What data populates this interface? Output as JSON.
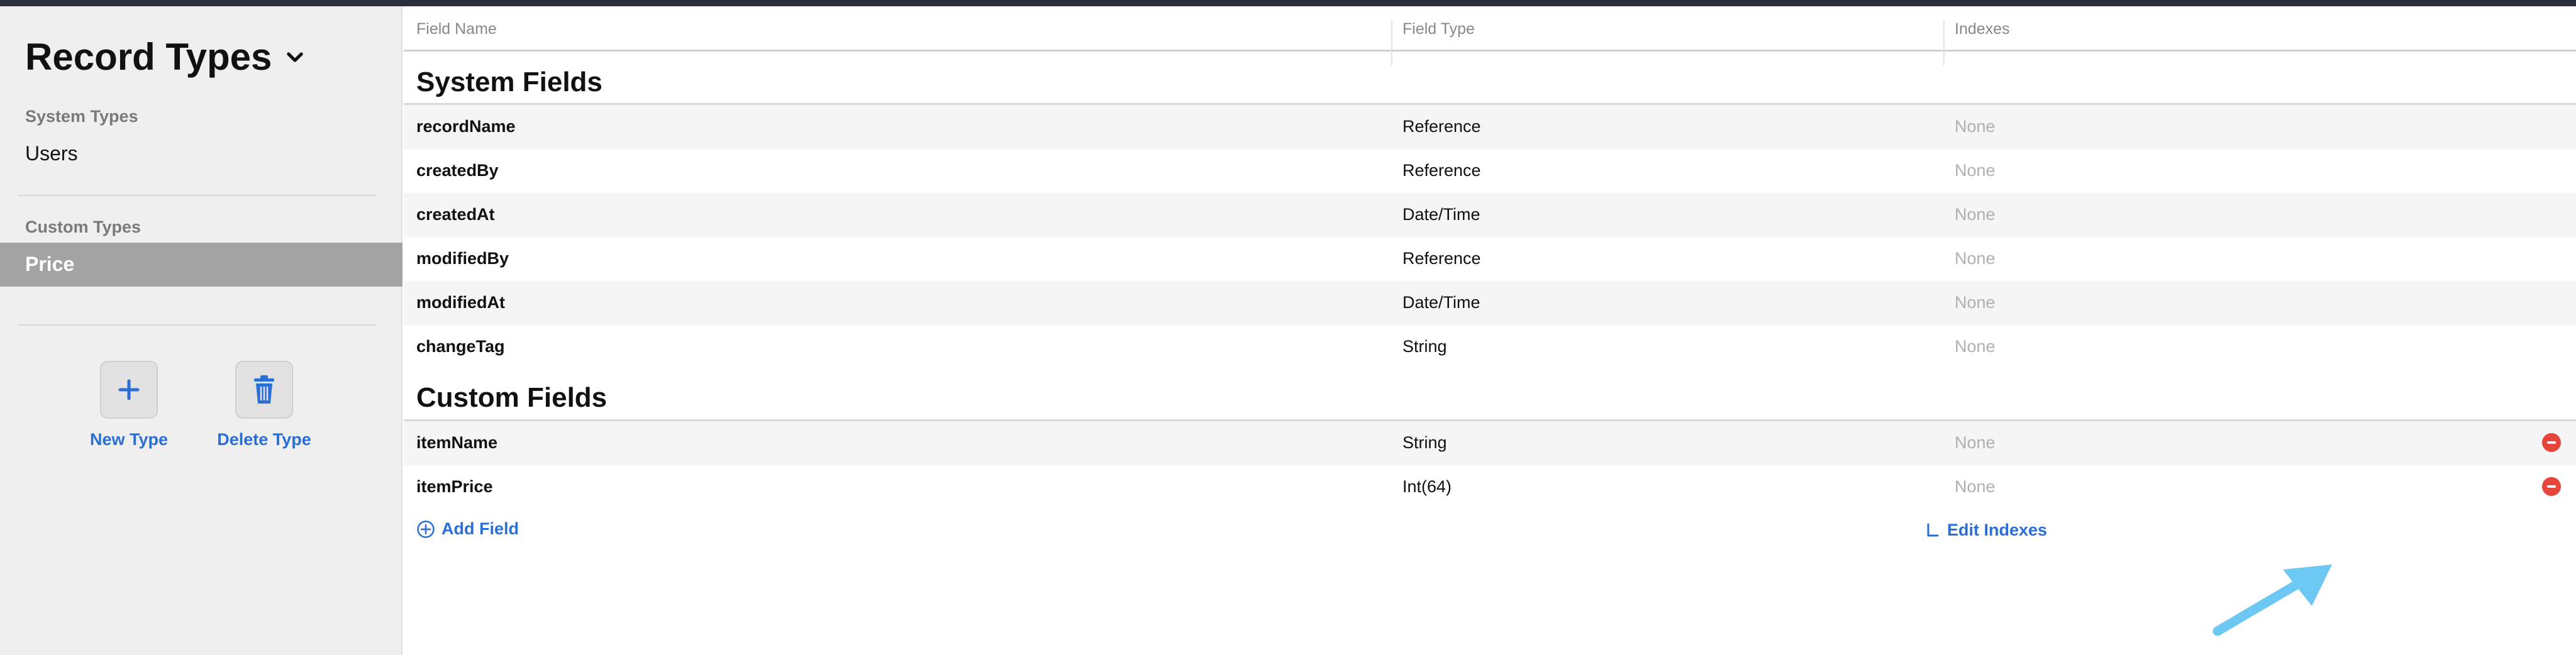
{
  "sidebar": {
    "title": "Record Types",
    "system_label": "System Types",
    "system_items": [
      "Users"
    ],
    "custom_label": "Custom Types",
    "custom_items": [
      "Price"
    ],
    "new_type": "New Type",
    "delete_type": "Delete Type"
  },
  "table": {
    "headers": [
      "Field Name",
      "Field Type",
      "Indexes"
    ],
    "system_section": "System Fields",
    "system_rows": [
      {
        "name": "recordName",
        "type": "Reference",
        "index": "None"
      },
      {
        "name": "createdBy",
        "type": "Reference",
        "index": "None"
      },
      {
        "name": "createdAt",
        "type": "Date/Time",
        "index": "None"
      },
      {
        "name": "modifiedBy",
        "type": "Reference",
        "index": "None"
      },
      {
        "name": "modifiedAt",
        "type": "Date/Time",
        "index": "None"
      },
      {
        "name": "changeTag",
        "type": "String",
        "index": "None"
      }
    ],
    "custom_section": "Custom Fields",
    "custom_rows": [
      {
        "name": "itemName",
        "type": "String",
        "index": "None"
      },
      {
        "name": "itemPrice",
        "type": "Int(64)",
        "index": "None"
      }
    ],
    "add_field": "Add Field",
    "edit_indexes": "Edit Indexes"
  },
  "colors": {
    "accent": "#2a6fd6",
    "remove": "#e5453a",
    "selected": "#a3a3a3",
    "arrow": "#6cc8f2"
  }
}
